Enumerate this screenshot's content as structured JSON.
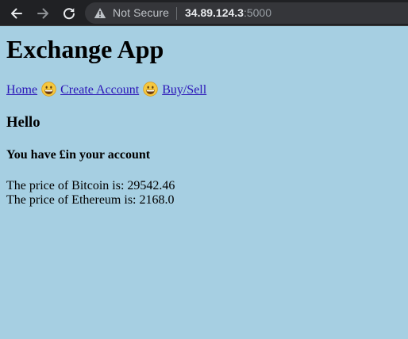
{
  "browser": {
    "security_label": "Not Secure",
    "url_host": "34.89.124.3",
    "url_port": ":5000",
    "icons": {
      "back": "arrow-left-icon",
      "forward": "arrow-right-icon",
      "reload": "reload-icon",
      "security": "warning-triangle-icon"
    }
  },
  "page": {
    "title": "Exchange App",
    "nav": {
      "home": "Home",
      "create_account": "Create Account",
      "buy_sell": "Buy/Sell",
      "separator_icon": "grinning-face-emoji"
    },
    "greeting": "Hello",
    "balance_text": "You have £in your account",
    "bitcoin_price_text": "The price of Bitcoin is: 29542.46",
    "ethereum_price_text": "The price of Ethereum is: 2168.0"
  },
  "colors": {
    "page_background": "#a6cfe2",
    "link": "#2a15b8",
    "chrome_background": "#202124"
  }
}
